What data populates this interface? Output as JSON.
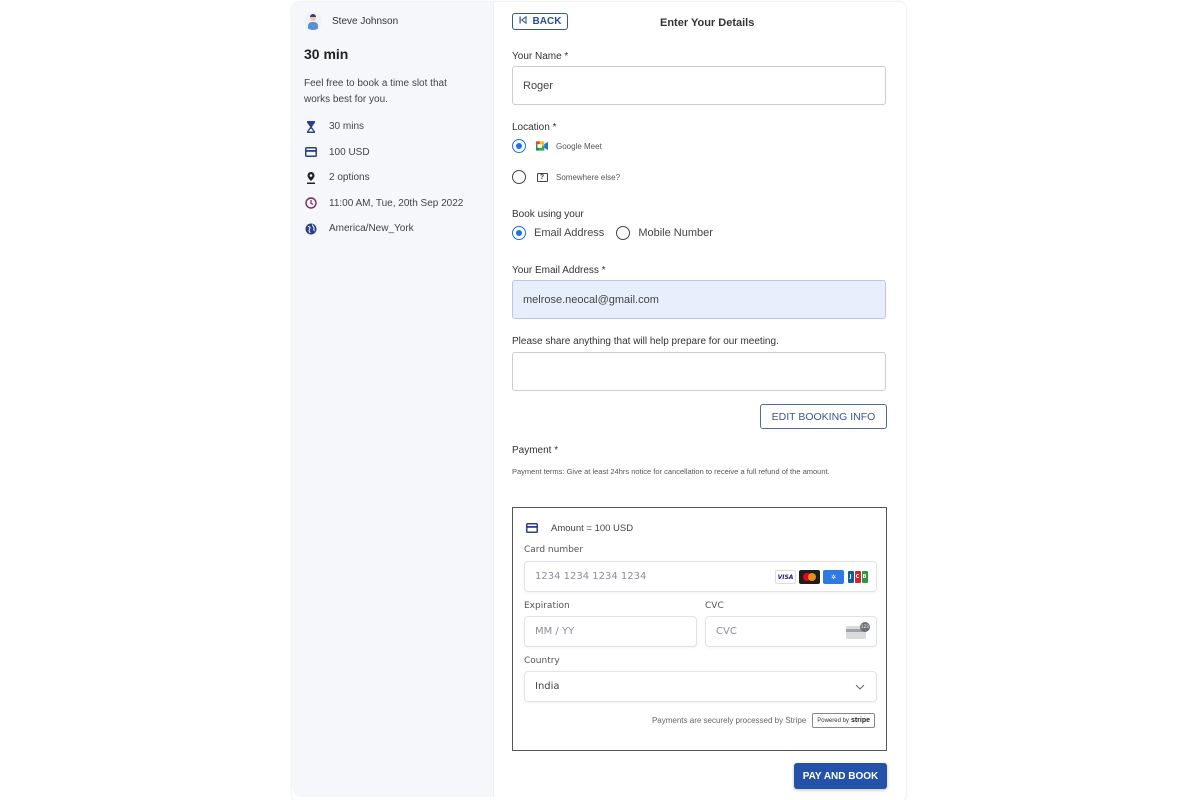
{
  "sidebar": {
    "host_name": "Steve Johnson",
    "duration_title": "30 min",
    "description": "Feel free to book a time slot that works best for you.",
    "meta": [
      {
        "icon": "hourglass-icon",
        "label": "30 mins"
      },
      {
        "icon": "credit-card-icon",
        "label": "100 USD"
      },
      {
        "icon": "location-pin-icon",
        "label": "2 options"
      },
      {
        "icon": "clock-icon",
        "label": "11:00 AM, Tue, 20th Sep 2022"
      },
      {
        "icon": "globe-icon",
        "label": "America/New_York"
      }
    ]
  },
  "header": {
    "back_label": "BACK",
    "title": "Enter Your Details"
  },
  "form": {
    "name_label": "Your Name *",
    "name_value": "Roger",
    "location_label": "Location *",
    "location_options": [
      {
        "label": "Google Meet",
        "selected": true
      },
      {
        "label": "Somewhere else?",
        "selected": false
      }
    ],
    "book_using_label": "Book using your",
    "book_using_options": [
      {
        "label": "Email Address",
        "selected": true
      },
      {
        "label": "Mobile Number",
        "selected": false
      }
    ],
    "email_label": "Your Email Address *",
    "email_value": "melrose.neocal@gmail.com",
    "notes_label": "Please share anything that will help prepare for our meeting.",
    "notes_value": "",
    "edit_button": "EDIT BOOKING INFO"
  },
  "payment": {
    "label": "Payment *",
    "terms": "Payment terms: Give at least 24hrs notice for cancellation to receive a full refund of the amount.",
    "amount": "Amount = 100 USD",
    "card_number_label": "Card number",
    "card_number_placeholder": "1234 1234 1234 1234",
    "card_brands": [
      "VISA",
      "Mastercard",
      "American Express",
      "JCB"
    ],
    "expiration_label": "Expiration",
    "expiration_placeholder": "MM / YY",
    "cvc_label": "CVC",
    "cvc_placeholder": "CVC",
    "country_label": "Country",
    "country_value": "India",
    "secure_note": "Payments are securely processed by Stripe",
    "powered_by": "Powered by",
    "stripe": "stripe",
    "pay_button": "PAY AND BOOK"
  },
  "colors": {
    "primary": "#2452a8",
    "radio_selected": "#1a73e8",
    "sidebar_bg": "#f6f7fb",
    "email_fill": "#e8effc"
  }
}
